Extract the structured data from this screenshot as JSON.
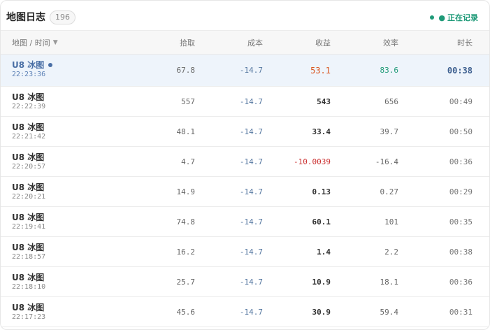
{
  "header": {
    "title": "地图日志",
    "count": "196",
    "recording_bullet": "●",
    "recording_label": "正在记录"
  },
  "columns": {
    "map_time": "地图 / 时间",
    "sort_icon": "▼",
    "pickup": "拾取",
    "cost": "成本",
    "gain": "收益",
    "efficiency": "效率",
    "duration": "时长"
  },
  "rows": [
    {
      "map": "U8 冰图",
      "time": "22:23:36",
      "pickup": "67.8",
      "cost": "-14.7",
      "gain": "53.1",
      "efficiency": "83.6",
      "duration": "00:38"
    },
    {
      "map": "U8 冰图",
      "time": "22:22:39",
      "pickup": "557",
      "cost": "-14.7",
      "gain": "543",
      "efficiency": "656",
      "duration": "00:49"
    },
    {
      "map": "U8 冰图",
      "time": "22:21:42",
      "pickup": "48.1",
      "cost": "-14.7",
      "gain": "33.4",
      "efficiency": "39.7",
      "duration": "00:50"
    },
    {
      "map": "U8 冰图",
      "time": "22:20:57",
      "pickup": "4.7",
      "cost": "-14.7",
      "gain": "-10.0039",
      "efficiency": "-16.4",
      "duration": "00:36"
    },
    {
      "map": "U8 冰图",
      "time": "22:20:21",
      "pickup": "14.9",
      "cost": "-14.7",
      "gain": "0.13",
      "efficiency": "0.27",
      "duration": "00:29"
    },
    {
      "map": "U8 冰图",
      "time": "22:19:41",
      "pickup": "74.8",
      "cost": "-14.7",
      "gain": "60.1",
      "efficiency": "101",
      "duration": "00:35"
    },
    {
      "map": "U8 冰图",
      "time": "22:18:57",
      "pickup": "16.2",
      "cost": "-14.7",
      "gain": "1.4",
      "efficiency": "2.2",
      "duration": "00:38"
    },
    {
      "map": "U8 冰图",
      "time": "22:18:10",
      "pickup": "25.7",
      "cost": "-14.7",
      "gain": "10.9",
      "efficiency": "18.1",
      "duration": "00:36"
    },
    {
      "map": "U8 冰图",
      "time": "22:17:23",
      "pickup": "45.6",
      "cost": "-14.7",
      "gain": "30.9",
      "efficiency": "59.4",
      "duration": "00:31"
    }
  ],
  "colors": {
    "accent": "#4a6fa5",
    "recording": "#1f9a78",
    "negative": "#cc3333",
    "highlight_gain": "#d9541e",
    "selected_row_bg": "#eef4fb"
  }
}
